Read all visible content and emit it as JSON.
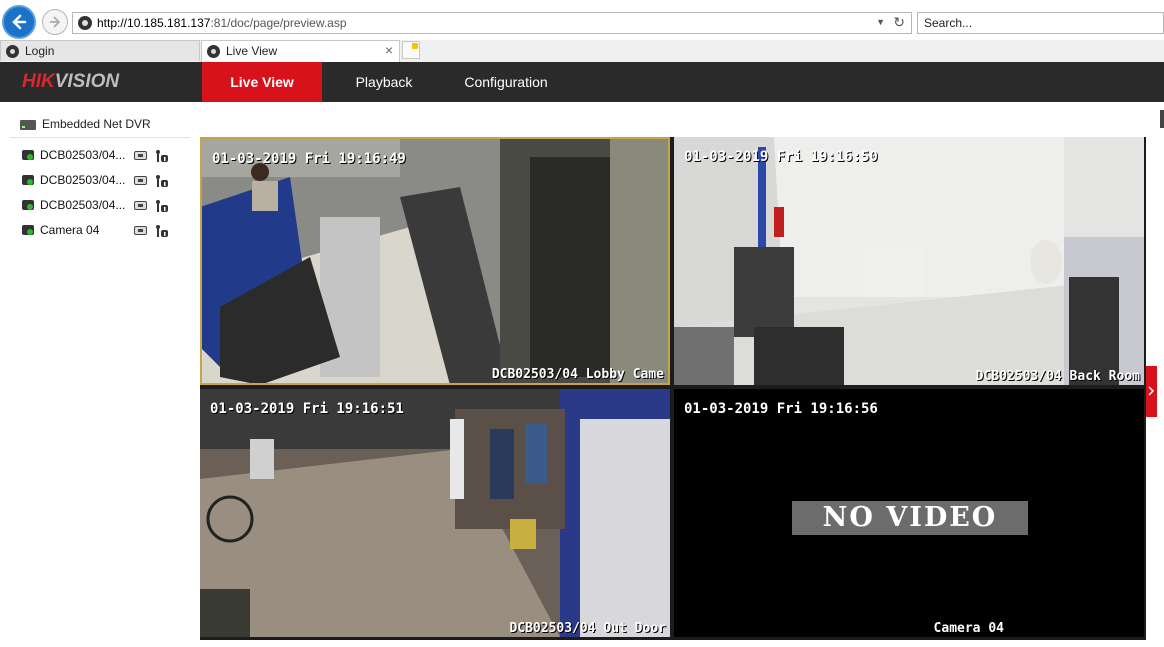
{
  "browser": {
    "url_host": "http://10.185.181.137",
    "url_rest": ":81/doc/page/preview.asp",
    "search_placeholder": "Search...",
    "tabs": [
      {
        "label": "Login",
        "active": false
      },
      {
        "label": "Live View",
        "active": true,
        "close": "×"
      }
    ]
  },
  "app": {
    "logo_hik": "HIK",
    "logo_vision": "VISION",
    "nav": [
      {
        "label": "Live View",
        "active": true
      },
      {
        "label": "Playback",
        "active": false
      },
      {
        "label": "Configuration",
        "active": false
      }
    ]
  },
  "sidebar": {
    "device": "Embedded Net DVR",
    "cameras": [
      {
        "label": "DCB02503/04..."
      },
      {
        "label": "DCB02503/04..."
      },
      {
        "label": "DCB02503/04..."
      },
      {
        "label": "Camera 04"
      }
    ]
  },
  "video": {
    "cells": [
      {
        "time": "01-03-2019 Fri 19:16:49",
        "name": "DCB02503/04 Lobby Came",
        "selected": true,
        "status": ""
      },
      {
        "time": "01-03-2019 Fri 19:16:50",
        "name": "DCB02503/04 Back Room",
        "selected": false,
        "status": ""
      },
      {
        "time": "01-03-2019 Fri 19:16:51",
        "name": "DCB02503/04 Out Door",
        "selected": false,
        "status": ""
      },
      {
        "time": "01-03-2019 Fri 19:16:56",
        "name": "Camera 04",
        "selected": false,
        "status": "NO VIDEO"
      }
    ]
  },
  "colors": {
    "accent": "#d8121b",
    "header_bg": "#2a2a2a",
    "selected_border": "#c9a34a"
  }
}
